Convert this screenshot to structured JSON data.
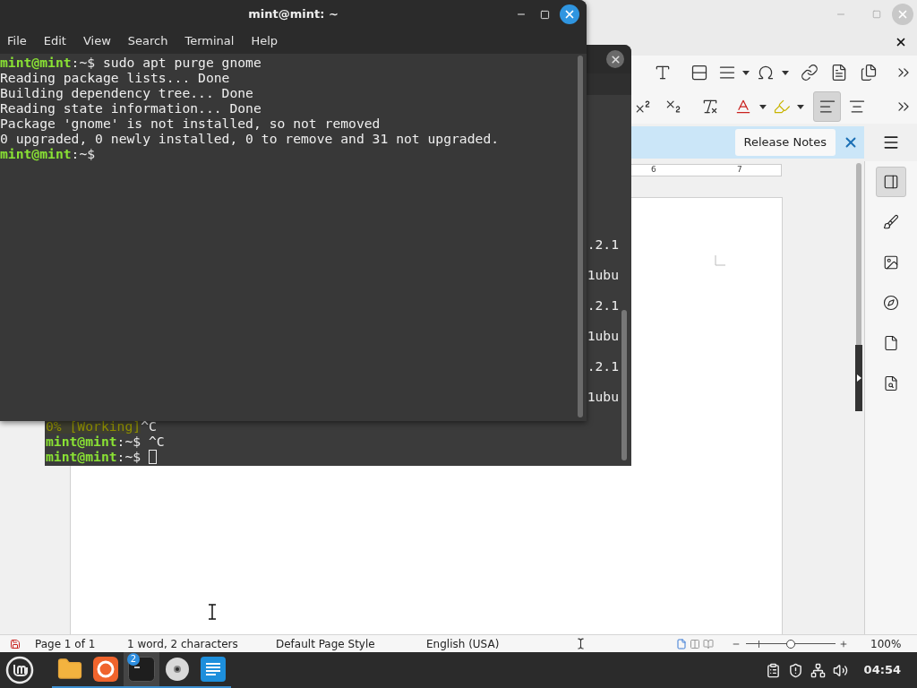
{
  "writer": {
    "align_buttons": [
      {
        "kind": "left",
        "selected": true
      },
      {
        "kind": "center",
        "selected": false
      }
    ],
    "infobar": {
      "button": "Release Notes"
    },
    "ruler": {
      "labels": [
        "6",
        "7"
      ]
    },
    "sidebar": {
      "tabs": [
        {
          "kind": "properties",
          "selected": true
        },
        {
          "kind": "styles",
          "selected": false
        },
        {
          "kind": "gallery",
          "selected": false
        },
        {
          "kind": "navigator",
          "selected": false
        },
        {
          "kind": "page",
          "selected": false
        },
        {
          "kind": "find",
          "selected": false
        }
      ]
    },
    "status_bar": {
      "page": "Page 1 of 1",
      "words": "1 word, 2 characters",
      "page_style": "Default Page Style",
      "language": "English (USA)",
      "zoom": {
        "level": 0.5,
        "reading": "100%"
      }
    }
  },
  "back_terminal": {
    "fragments": [
      ".2.1",
      "1ubu",
      ".2.1",
      "1ubu",
      ".2.1",
      "1ubu"
    ],
    "lines": [
      {
        "kind": "status",
        "text": "0% [Working]",
        "tail": "^C"
      },
      {
        "kind": "prompt",
        "user": "mint@mint",
        "path": ":~$",
        "command": "^C",
        "cursor": false
      },
      {
        "kind": "prompt",
        "user": "mint@mint",
        "path": ":~$",
        "cursor": true
      }
    ]
  },
  "front_terminal": {
    "title": "mint@mint: ~",
    "menu": [
      "File",
      "Edit",
      "View",
      "Search",
      "Terminal",
      "Help"
    ],
    "lines": [
      {
        "kind": "prompt",
        "user": "mint@mint",
        "path": ":~$",
        "command": "sudo apt purge gnome",
        "cursor": false
      },
      {
        "kind": "output",
        "text": "Reading package lists... Done"
      },
      {
        "kind": "output",
        "text": "Building dependency tree... Done"
      },
      {
        "kind": "output",
        "text": "Reading state information... Done"
      },
      {
        "kind": "output",
        "text": "Package 'gnome' is not installed, so not removed"
      },
      {
        "kind": "output",
        "text": "0 upgraded, 0 newly installed, 0 to remove and 31 not upgraded."
      },
      {
        "kind": "prompt",
        "user": "mint@mint",
        "path": ":~$",
        "cursor": false
      }
    ]
  },
  "taskbar": {
    "apps": [
      {
        "kind": "files",
        "selected": false
      },
      {
        "kind": "firefox",
        "selected": false
      },
      {
        "kind": "terminal",
        "selected": true,
        "badge": "2"
      },
      {
        "kind": "disc",
        "selected": false
      },
      {
        "kind": "writer",
        "selected": false
      }
    ],
    "clock": "04:54"
  }
}
